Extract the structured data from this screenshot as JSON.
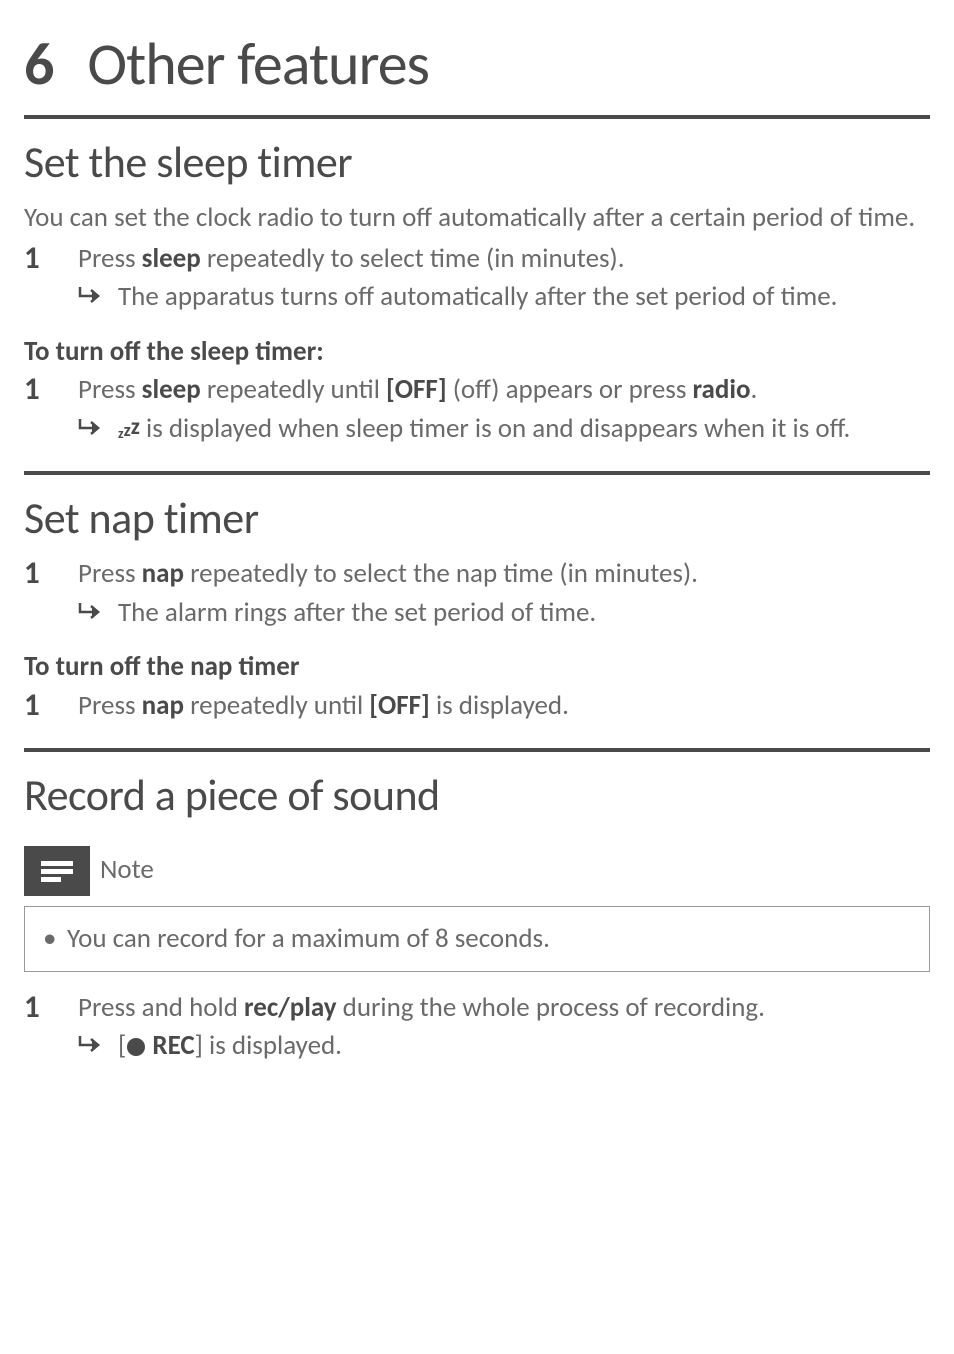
{
  "chapter": {
    "number": "6",
    "title": "Other features"
  },
  "sections": {
    "sleep": {
      "title": "Set the sleep timer",
      "intro": "You can set the clock radio to turn off automatically after a certain period of time.",
      "step1_num": "1",
      "step1_pre": "Press ",
      "step1_btn": "sleep",
      "step1_post": " repeatedly to select time (in minutes).",
      "result1": "The apparatus turns off automatically after the set period of time.",
      "off_heading": "To turn off the sleep timer:",
      "off_step_num": "1",
      "off_pre": "Press ",
      "off_btn": "sleep",
      "off_mid": " repeatedly until ",
      "off_code": "[OFF]",
      "off_post1": " (off) appears or press ",
      "off_btn2": "radio",
      "off_post2": ".",
      "off_result_post": " is displayed when sleep timer is on and disappears when it is off."
    },
    "nap": {
      "title": "Set nap timer",
      "step1_num": "1",
      "step1_pre": "Press ",
      "step1_btn": "nap",
      "step1_post": " repeatedly to select the nap time (in minutes).",
      "result1": "The alarm rings after the set period of time.",
      "off_heading": "To turn off the nap timer",
      "off_step_num": "1",
      "off_pre": "Press ",
      "off_btn": "nap",
      "off_mid": " repeatedly until ",
      "off_code": "[OFF]",
      "off_post": " is displayed."
    },
    "record": {
      "title": "Record a piece of sound",
      "note_label": "Note",
      "note_text": "You can record for a maximum of 8 seconds.",
      "step1_num": "1",
      "step1_pre": "Press and hold ",
      "step1_btn": "rec/play",
      "step1_post": " during the whole process of recording.",
      "result_pre": "[",
      "result_code": "REC",
      "result_post": "] is displayed."
    }
  }
}
